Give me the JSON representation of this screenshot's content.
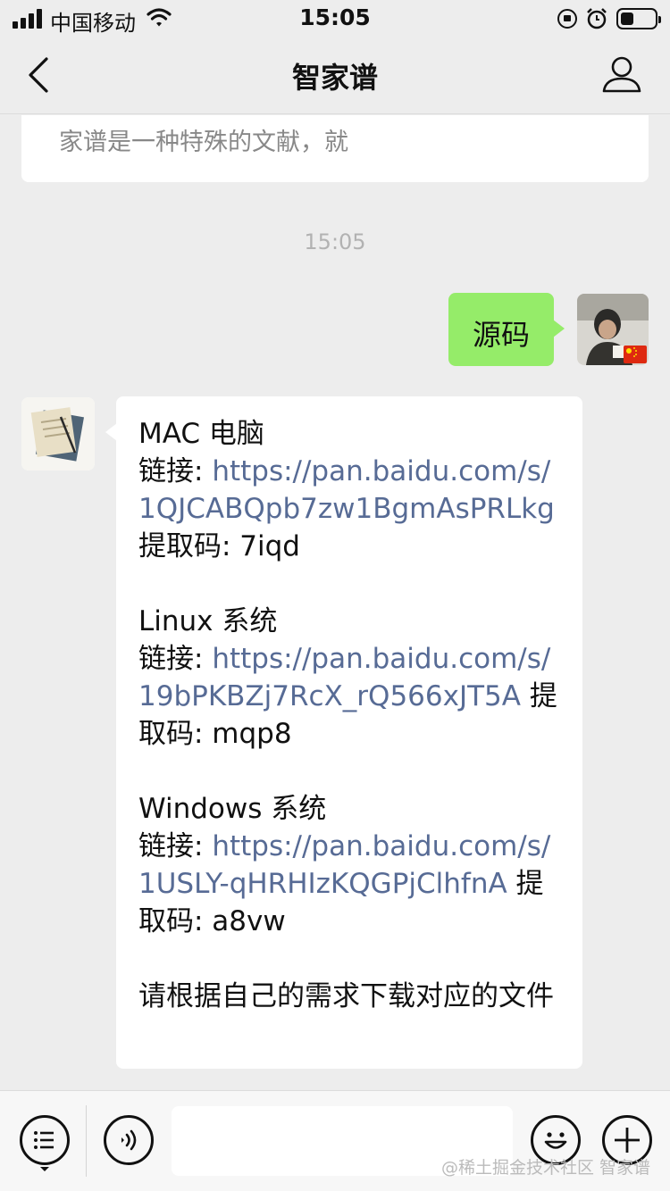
{
  "status_bar": {
    "carrier": "中国移动",
    "time": "15:05"
  },
  "nav": {
    "title": "智家谱"
  },
  "card": {
    "text": "家谱是一种特殊的文献，就"
  },
  "chat": {
    "timestamp": "15:05",
    "my_message": "源码",
    "bot_message": {
      "mac_title": "MAC 电脑",
      "mac_link_label": "链接: ",
      "mac_link": "https://pan.baidu.com/s/1QJCABQpb7zw1BgmAsPRLkg",
      "mac_code": "提取码: 7iqd",
      "linux_title": "Linux 系统",
      "linux_link_label": "链接: ",
      "linux_link": "https://pan.baidu.com/s/19bPKBZj7RcX_rQ566xJT5A",
      "linux_code": " 提取码: mqp8",
      "windows_title": "Windows 系统",
      "windows_link_label": "链接: ",
      "windows_link": "https://pan.baidu.com/s/1USLY-qHRHIzKQGPjClhfnA",
      "windows_code": " 提取码: a8vw",
      "note": "请根据自己的需求下载对应的文件"
    }
  },
  "input_bar": {
    "input_value": ""
  },
  "watermark": "@稀土掘金技术社区 智家谱",
  "colors": {
    "bubble_me": "#95ec69",
    "link": "#576b95",
    "background": "#ededed"
  },
  "icons": [
    "signal-icon",
    "wifi-icon",
    "lock-rotation-icon",
    "alarm-icon",
    "battery-icon",
    "back-icon",
    "profile-icon",
    "menu-icon",
    "voice-icon",
    "emoji-icon",
    "plus-icon"
  ]
}
